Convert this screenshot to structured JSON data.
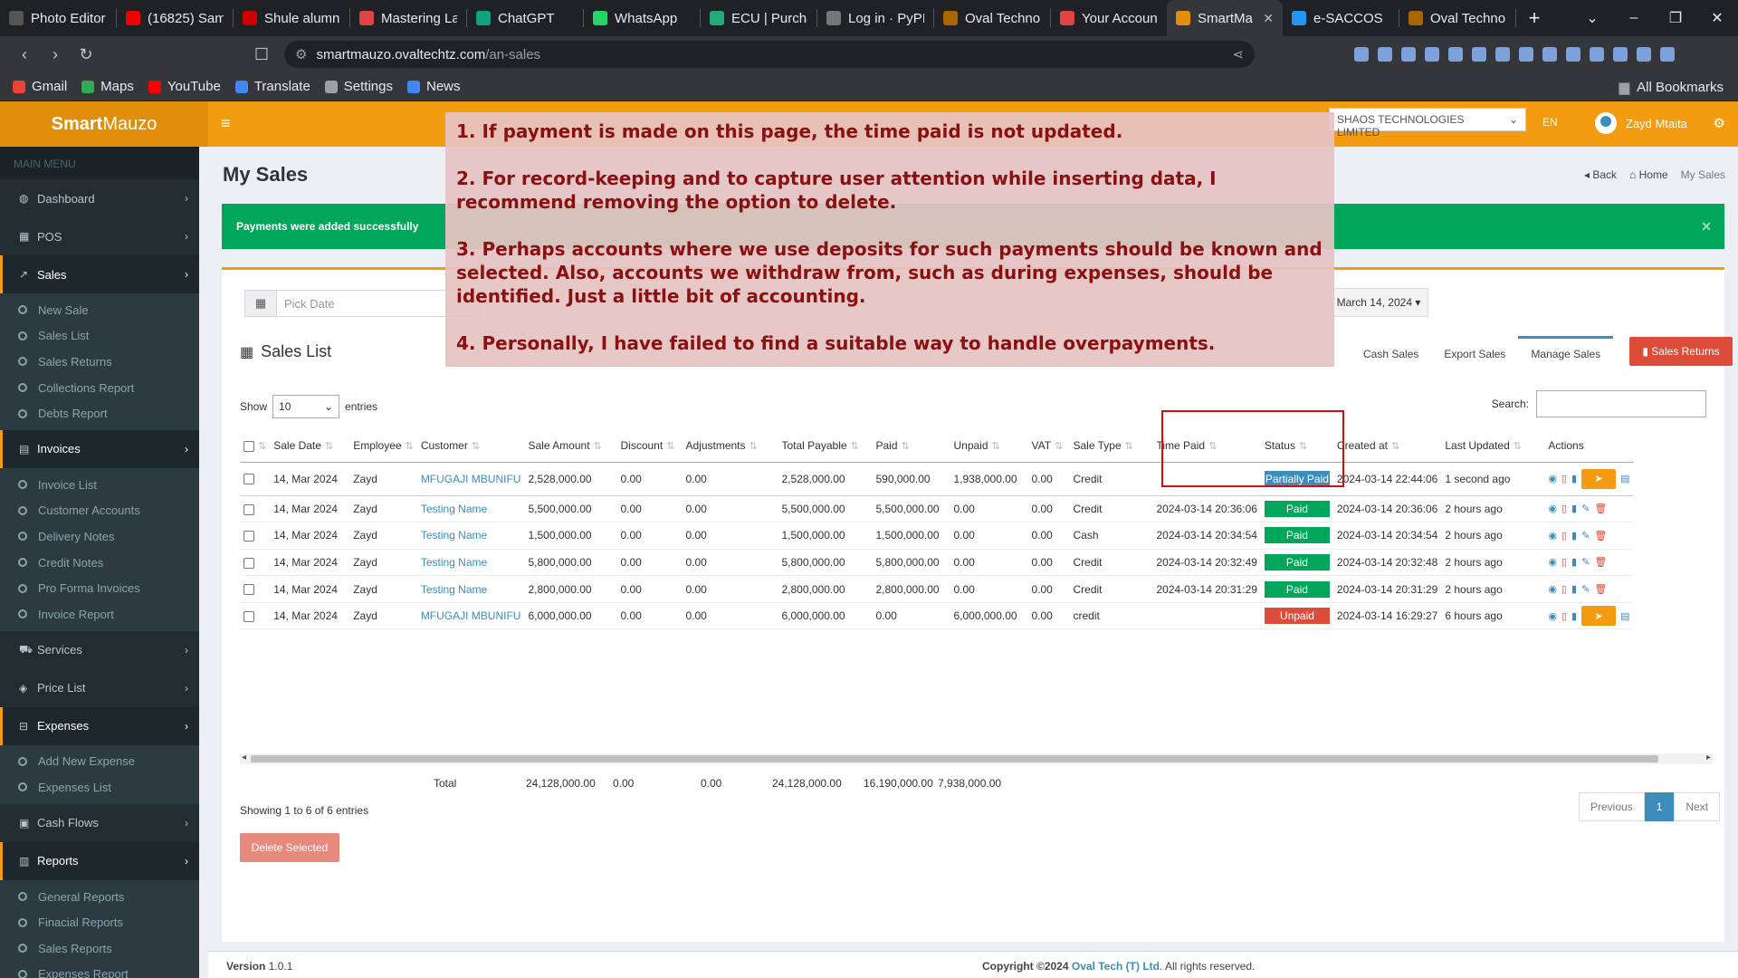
{
  "browser": {
    "tabs": [
      {
        "label": "Photo Editor",
        "color": "#555"
      },
      {
        "label": "(16825) Sam",
        "color": "#e00"
      },
      {
        "label": "Shule alumn",
        "color": "#c00"
      },
      {
        "label": "Mastering La",
        "color": "#d44"
      },
      {
        "label": "ChatGPT",
        "color": "#10a37f"
      },
      {
        "label": "WhatsApp",
        "color": "#25d366"
      },
      {
        "label": "ECU | Purcha",
        "color": "#2a7"
      },
      {
        "label": "Log in · PyPI",
        "color": "#777"
      },
      {
        "label": "Oval Techno",
        "color": "#a60"
      },
      {
        "label": "Your Accoun",
        "color": "#d44"
      },
      {
        "label": "SmartMa",
        "color": "#e08e0b",
        "active": true
      },
      {
        "label": "e-SACCOS",
        "color": "#2196f3"
      },
      {
        "label": "Oval Techno",
        "color": "#a60"
      }
    ],
    "url_host": "smartmauzo.ovaltechtz.com",
    "url_path": "/an-sales",
    "bookmarks": [
      {
        "label": "Gmail",
        "color": "#ea4335"
      },
      {
        "label": "Maps",
        "color": "#34a853"
      },
      {
        "label": "YouTube",
        "color": "#ff0000"
      },
      {
        "label": "Translate",
        "color": "#4285f4"
      },
      {
        "label": "Settings",
        "color": "#9aa0a6"
      },
      {
        "label": "News",
        "color": "#4285f4"
      }
    ],
    "all_bookmarks": "All Bookmarks"
  },
  "app": {
    "logo_bold": "Smart",
    "logo_rest": "Mauzo",
    "company": "SHAOS TECHNOLOGIES LIMITED",
    "lang": "EN",
    "user": "Zayd Mtaita"
  },
  "sidebar": {
    "header": "MAIN MENU",
    "dashboard": "Dashboard",
    "pos": "POS",
    "sales": "Sales",
    "sales_items": [
      "New Sale",
      "Sales List",
      "Sales Returns",
      "Collections Report",
      "Debts Report"
    ],
    "invoices": "Invoices",
    "invoice_items": [
      "Invoice List",
      "Customer Accounts",
      "Delivery Notes",
      "Credit Notes",
      "Pro Forma Invoices",
      "Invoice Report"
    ],
    "services": "Services",
    "price_list": "Price List",
    "expenses": "Expenses",
    "expense_items": [
      "Add New Expense",
      "Expenses List"
    ],
    "cash_flows": "Cash Flows",
    "reports": "Reports",
    "report_items": [
      "General Reports",
      "Finacial Reports",
      "Sales Reports",
      "Expenses Report"
    ]
  },
  "page": {
    "title": "My Sales",
    "back": "Back",
    "home": "Home",
    "crumb": "My Sales",
    "alert": "Payments were added successfully",
    "date_placeholder": "Pick Date",
    "date_button": "March 14, 2024",
    "list_title": "Sales List",
    "tabs": [
      "Cash Sales",
      "Export Sales",
      "Manage Sales"
    ],
    "sales_returns": "Sales Returns",
    "show": "Show",
    "entries_value": "10",
    "entries": "entries",
    "search": "Search:"
  },
  "table": {
    "headers": [
      "Sale Date",
      "Employee",
      "Customer",
      "Sale Amount",
      "Discount",
      "Adjustments",
      "Total Payable",
      "Paid",
      "Unpaid",
      "VAT",
      "Sale Type",
      "Time Paid",
      "Status",
      "Created at",
      "Last Updated",
      "Actions"
    ],
    "rows": [
      {
        "date": "14, Mar 2024",
        "employee": "Zayd",
        "customer": "MFUGAJI MBUNIFU",
        "amount": "2,528,000.00",
        "discount": "0.00",
        "adjust": "0.00",
        "payable": "2,528,000.00",
        "paid": "590,000.00",
        "unpaid": "1,938,000.00",
        "vat": "0.00",
        "type": "Credit",
        "time_paid": "",
        "status": "Partially Paid",
        "created": "2024-03-14 22:44:06",
        "updated": "1 second ago"
      },
      {
        "date": "14, Mar 2024",
        "employee": "Zayd",
        "customer": "Testing Name",
        "amount": "5,500,000.00",
        "discount": "0.00",
        "adjust": "0.00",
        "payable": "5,500,000.00",
        "paid": "5,500,000.00",
        "unpaid": "0.00",
        "vat": "0.00",
        "type": "Credit",
        "time_paid": "2024-03-14 20:36:06",
        "status": "Paid",
        "created": "2024-03-14 20:36:06",
        "updated": "2 hours ago"
      },
      {
        "date": "14, Mar 2024",
        "employee": "Zayd",
        "customer": "Testing Name",
        "amount": "1,500,000.00",
        "discount": "0.00",
        "adjust": "0.00",
        "payable": "1,500,000.00",
        "paid": "1,500,000.00",
        "unpaid": "0.00",
        "vat": "0.00",
        "type": "Cash",
        "time_paid": "2024-03-14 20:34:54",
        "status": "Paid",
        "created": "2024-03-14 20:34:54",
        "updated": "2 hours ago"
      },
      {
        "date": "14, Mar 2024",
        "employee": "Zayd",
        "customer": "Testing Name",
        "amount": "5,800,000.00",
        "discount": "0.00",
        "adjust": "0.00",
        "payable": "5,800,000.00",
        "paid": "5,800,000.00",
        "unpaid": "0.00",
        "vat": "0.00",
        "type": "Credit",
        "time_paid": "2024-03-14 20:32:49",
        "status": "Paid",
        "created": "2024-03-14 20:32:48",
        "updated": "2 hours ago"
      },
      {
        "date": "14, Mar 2024",
        "employee": "Zayd",
        "customer": "Testing Name",
        "amount": "2,800,000.00",
        "discount": "0.00",
        "adjust": "0.00",
        "payable": "2,800,000.00",
        "paid": "2,800,000.00",
        "unpaid": "0.00",
        "vat": "0.00",
        "type": "Credit",
        "time_paid": "2024-03-14 20:31:29",
        "status": "Paid",
        "created": "2024-03-14 20:31:29",
        "updated": "2 hours ago"
      },
      {
        "date": "14, Mar 2024",
        "employee": "Zayd",
        "customer": "MFUGAJI MBUNIFU",
        "amount": "6,000,000.00",
        "discount": "0.00",
        "adjust": "0.00",
        "payable": "6,000,000.00",
        "paid": "0.00",
        "unpaid": "6,000,000.00",
        "vat": "0.00",
        "type": "credit",
        "time_paid": "",
        "status": "Unpaid",
        "created": "2024-03-14 16:29:27",
        "updated": "6 hours ago"
      }
    ],
    "totals": {
      "label": "Total",
      "amount": "24,128,000.00",
      "discount": "0.00",
      "adjust": "0.00",
      "payable": "24,128,000.00",
      "paid": "16,190,000.00",
      "unpaid": "7,938,000.00"
    }
  },
  "footer_area": {
    "showing": "Showing 1 to 6 of 6 entries",
    "previous": "Previous",
    "page": "1",
    "next": "Next",
    "delete_selected": "Delete Selected",
    "version_label": "Version",
    "version": "1.0.1",
    "copyright": "Copyright ©2024",
    "company_link": "Oval Tech (T) Ltd",
    "rights": ". All rights reserved."
  },
  "annotation": {
    "notes": [
      "1. If payment is made on this page, the time paid is not updated.",
      "2. For record-keeping and to capture user attention while inserting data, I recommend removing the option to delete.",
      "3. Perhaps accounts where we use deposits for such payments should be known and selected. Also, accounts we withdraw from, such as during expenses, should be identified. Just a little bit of accounting.",
      "4. Personally, I have failed to find a suitable way to handle overpayments."
    ]
  },
  "colors": {
    "brand": "#f39c12",
    "sidebar": "#222d32",
    "success": "#00a65a",
    "danger": "#dd4b39",
    "link": "#3c8dbc"
  }
}
